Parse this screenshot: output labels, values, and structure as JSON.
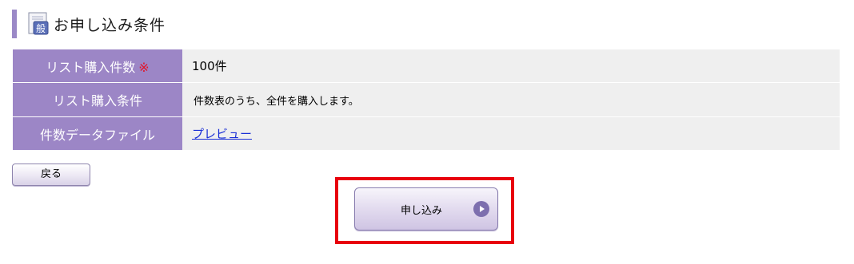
{
  "section": {
    "title": "お申し込み条件",
    "icon_glyph": "般",
    "icon": "document-icon"
  },
  "conditions": {
    "rows": [
      {
        "label": "リスト購入件数",
        "required_mark": "※",
        "value": "100件"
      },
      {
        "label": "リスト購入条件",
        "value": "件数表のうち、全件を購入します。"
      },
      {
        "label": "件数データファイル",
        "value": "プレビュー"
      }
    ]
  },
  "buttons": {
    "back_label": "戻る",
    "apply_label": "申し込み",
    "apply_icon": "play-icon"
  },
  "colors": {
    "header_bar": "#9b89c7",
    "table_header": "#9c86c6",
    "table_cell": "#efefef",
    "required": "#e0152a",
    "link": "#1a2fd6",
    "highlight": "#e8000d"
  }
}
